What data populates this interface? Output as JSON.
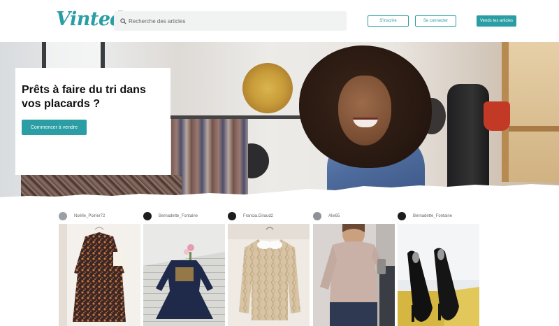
{
  "header": {
    "logo": "Vinted",
    "search_placeholder": "Recherche des articles",
    "register_label": "S'inscrire",
    "login_label": "Se connecter",
    "sell_label": "Vends tes articles"
  },
  "hero": {
    "title": "Prêts à faire du tri dans vos placards ?",
    "cta_label": "Commencer à vendre"
  },
  "colors": {
    "brand": "#2b9ea5"
  },
  "feed": {
    "items": [
      {
        "username": "Noëlle_Poirier72",
        "avatar_color": "#9aa0a6",
        "photo": "floral-dress-photo"
      },
      {
        "username": "Bernadette_Fontaine",
        "avatar_color": "#1d1d1f",
        "photo": "navy-girls-dress-photo"
      },
      {
        "username": "Francia.Giraud2",
        "avatar_color": "#1d1d1f",
        "photo": "beige-sweater-photo"
      },
      {
        "username": "Alix65",
        "avatar_color": "#8e9197",
        "photo": "pink-knit-top-photo"
      },
      {
        "username": "Bernadette_Fontaine",
        "avatar_color": "#1d1d1f",
        "photo": "black-heels-photo"
      }
    ]
  }
}
